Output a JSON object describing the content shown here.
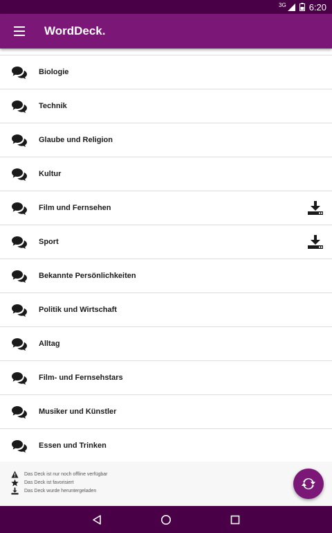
{
  "status_bar": {
    "network": "3G",
    "time": "6:20"
  },
  "app_bar": {
    "title": "WordDeck."
  },
  "decks": [
    {
      "label": "Biologie",
      "downloaded": false
    },
    {
      "label": "Technik",
      "downloaded": false
    },
    {
      "label": "Glaube und Religion",
      "downloaded": false
    },
    {
      "label": "Kultur",
      "downloaded": false
    },
    {
      "label": "Film und Fernsehen",
      "downloaded": true
    },
    {
      "label": "Sport",
      "downloaded": true
    },
    {
      "label": "Bekannte Persönlichkeiten",
      "downloaded": false
    },
    {
      "label": "Politik und Wirtschaft",
      "downloaded": false
    },
    {
      "label": "Alltag",
      "downloaded": false
    },
    {
      "label": "Film- und Fernsehstars",
      "downloaded": false
    },
    {
      "label": "Musiker und Künstler",
      "downloaded": false
    },
    {
      "label": "Essen und Trinken",
      "downloaded": false
    }
  ],
  "legend": {
    "offline": "Das Deck ist nur noch offline verfügbar",
    "favorite": "Das Deck ist favorisiert",
    "downloaded": "Das Deck wurde heruntergeladen"
  },
  "colors": {
    "primary": "#7b1777",
    "primary_dark": "#4a0046"
  },
  "icons": {
    "row": "chat-bubbles-icon",
    "download": "download-icon",
    "fab": "sync-icon",
    "menu": "hamburger-menu-icon"
  }
}
